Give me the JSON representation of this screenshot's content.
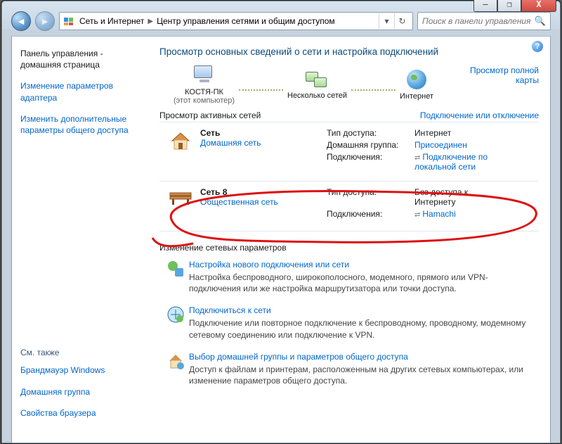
{
  "window": {
    "min": "—",
    "max": "❐",
    "close": "X"
  },
  "breadcrumb": {
    "seg1": "Сеть и Интернет",
    "seg2": "Центр управления сетями и общим доступом"
  },
  "search": {
    "placeholder": "Поиск в панели управления"
  },
  "help_tooltip": "?",
  "side": {
    "home_l1": "Панель управления -",
    "home_l2": "домашняя страница",
    "link1_l1": "Изменение параметров",
    "link1_l2": "адаптера",
    "link2_l1": "Изменить дополнительные",
    "link2_l2": "параметры общего доступа",
    "see_also": "См. также",
    "sa1": "Брандмауэр Windows",
    "sa2": "Домашняя группа",
    "sa3": "Свойства браузера"
  },
  "headline": "Просмотр основных сведений о сети и настройка подключений",
  "map": {
    "pc": "КОСТЯ-ПК",
    "pc_sub": "(этот компьютер)",
    "multi": "Несколько сетей",
    "internet": "Интернет",
    "fullmap": "Просмотр полной карты"
  },
  "active": {
    "title": "Просмотр активных сетей",
    "link": "Подключение или отключение"
  },
  "net1": {
    "name": "Сеть",
    "kind": "Домашняя сеть",
    "k1": "Тип доступа:",
    "v1": "Интернет",
    "k2": "Домашняя группа:",
    "v2": "Присоединен",
    "k3": "Подключения:",
    "v3a": "Подключение по",
    "v3b": "локальной сети"
  },
  "net2": {
    "name": "Сеть  8",
    "kind": "Общественная сеть",
    "k1": "Тип доступа:",
    "v1a": "Без доступа к",
    "v1b": "Интернету",
    "k2": "Подключения:",
    "v2": "Hamachi"
  },
  "change": "Изменение сетевых параметров",
  "tasks": {
    "t1_title": "Настройка нового подключения или сети",
    "t1_desc": "Настройка беспроводного, широкополосного, модемного, прямого или VPN-подключения или же настройка маршрутизатора или точки доступа.",
    "t2_title": "Подключиться к сети",
    "t2_desc": "Подключение или повторное подключение к беспроводному, проводному, модемному сетевому соединению или подключение к VPN.",
    "t3_title": "Выбор домашней группы и параметров общего доступа",
    "t3_desc": "Доступ к файлам и принтерам, расположенным на других сетевых компьютерах, или изменение параметров общего доступа."
  }
}
